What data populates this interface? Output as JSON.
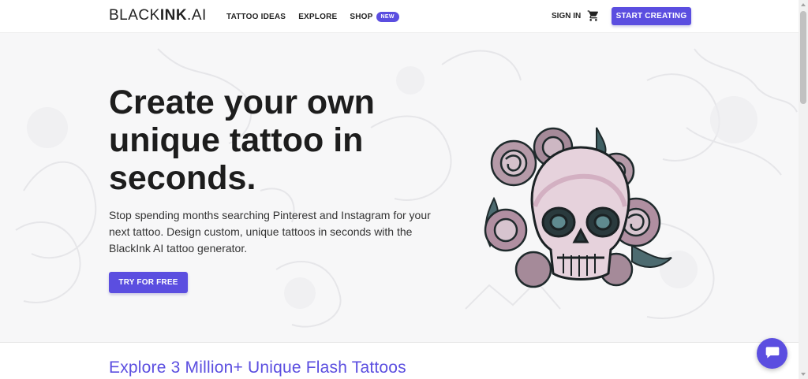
{
  "header": {
    "logo_light": "BLACK",
    "logo_bold": "INK",
    "logo_suffix": ".AI",
    "nav": [
      {
        "label": "TATTOO IDEAS"
      },
      {
        "label": "EXPLORE"
      },
      {
        "label": "SHOP",
        "badge": "NEW"
      }
    ],
    "signin_label": "SIGN IN",
    "cart_icon": "shopping-cart-icon",
    "start_label": "START CREATING"
  },
  "hero": {
    "title": "Create your own unique tattoo in seconds.",
    "subtitle": "Stop spending months searching Pinterest and Instagram for your next tattoo. Design custom, unique tattoos in seconds with the BlackInk AI tattoo generator.",
    "cta_label": "TRY FOR FREE",
    "image_icon": "skull-with-roses-tattoo-icon"
  },
  "explore": {
    "title": "Explore 3 Million+ Unique Flash Tattoos"
  },
  "chat": {
    "icon": "chat-bubble-icon"
  },
  "colors": {
    "accent": "#5b4ee0",
    "text": "#1d1d1d",
    "hero_bg": "#f7f7f8"
  }
}
